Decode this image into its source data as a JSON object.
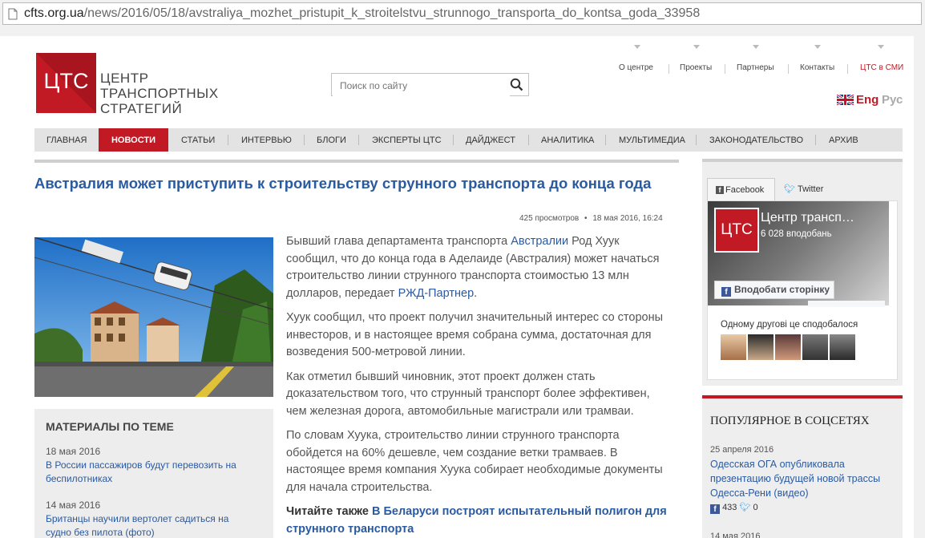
{
  "browser": {
    "url_host": "cfts.org.ua",
    "url_path": "/news/2016/05/18/avstraliya_mozhet_pristupit_k_stroitelstvu_strunnogo_transporta_do_kontsa_goda_33958"
  },
  "header": {
    "logo_text": "ЦТС",
    "brand_line1": "ЦЕНТР",
    "brand_line2": "ТРАНСПОРТНЫХ",
    "brand_line3": "СТРАТЕГИЙ",
    "search_placeholder": "Поиск по сайту",
    "top_links": [
      "О центре",
      "Проекты",
      "Партнеры",
      "Контакты",
      "ЦТС в СМИ"
    ],
    "lang_eng": "Eng",
    "lang_rus": "Рус"
  },
  "nav": [
    "ГЛАВНАЯ",
    "НОВОСТИ",
    "СТАТЬИ",
    "ИНТЕРВЬЮ",
    "БЛОГИ",
    "ЭКСПЕРТЫ ЦТС",
    "ДАЙДЖЕСТ",
    "АНАЛИТИКА",
    "МУЛЬТИМЕДИА",
    "ЗАКОНОДАТЕЛЬСТВО",
    "АРХИВ"
  ],
  "article": {
    "title": "Австралия может приступить к строительству струнного транспорта до конца года",
    "views": "425 просмотров",
    "date": "18 мая 2016, 16:24",
    "p1_a": "Бывший глава департамента транспорта ",
    "p1_link1": "Австралии",
    "p1_b": " Род Хуук сообщил, что до конца года в Аделаиде (Австралия) может начаться строительство линии струнного транспорта стоимостью 13 млн долларов, передает ",
    "p1_link2": "РЖД-Партнер",
    "p1_c": ".",
    "p2": "Хуук сообщил, что проект получил значительный интерес со стороны инвесторов, и в настоящее время собрана сумма, достаточная для возведения 500-метровой линии.",
    "p3": "Как отметил бывший чиновник, этот проект должен стать доказательством того, что струнный транспорт более эффективен, чем железная дорога, автомобильные магистрали или трамваи.",
    "p4": "По словам Хуука, строительство линии струнного транспорта обойдется на 60% дешевле, чем создание ветки трамваев. В настоящее время компания Хуука собирает необходимые документы для начала строительства.",
    "read_also_label": "Читайте также",
    "read_also_link": "В Беларуси построят испытательный полигон для струнного транспорта"
  },
  "related": {
    "heading": "МАТЕРИАЛЫ ПО ТЕМЕ",
    "items": [
      {
        "date": "18 мая 2016",
        "title": "В России пассажиров будут перевозить на беспилотниках"
      },
      {
        "date": "14 мая 2016",
        "title": "Британцы научили вертолет садиться на судно без пилота (фото)"
      }
    ]
  },
  "social": {
    "tab_facebook": "Facebook",
    "tab_twitter": "Twitter",
    "page_name": "Центр трансп…",
    "likes": "6 028 вподобань",
    "like_button": "Вподобати сторінку",
    "friends_text": "Одному другові це сподобалося"
  },
  "popular": {
    "heading": "ПОПУЛЯРНОЕ В СОЦСЕТЯХ",
    "date1": "25 апреля 2016",
    "title1": "Одесская ОГА опубликовала презентацию будущей новой трассы Одесса-Рени (видео)",
    "fb_count": "433",
    "tw_count": "0",
    "date2": "14 мая 2016"
  },
  "colors": {
    "brand_red": "#c21a24",
    "link_blue": "#2a5aa0"
  }
}
